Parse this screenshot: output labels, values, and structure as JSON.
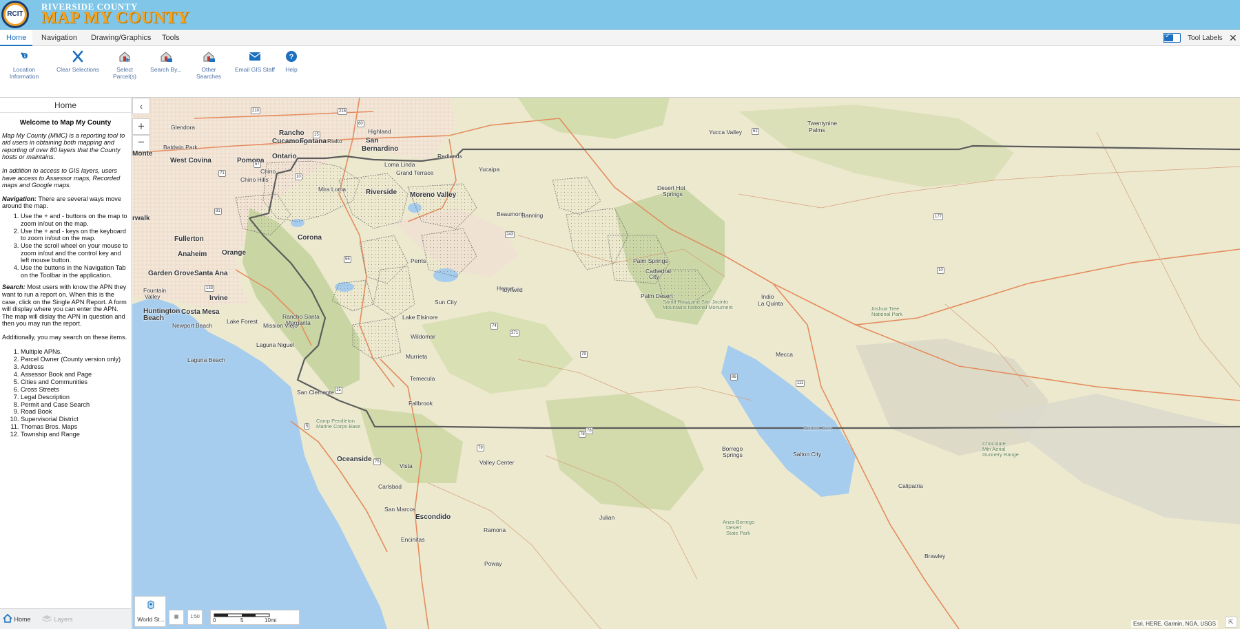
{
  "header": {
    "logo_text": "RCIT",
    "subtitle": "RIVERSIDE COUNTY",
    "title": "MAP MY COUNTY"
  },
  "menu": {
    "tabs": [
      {
        "label": "Home",
        "active": true
      },
      {
        "label": "Navigation"
      },
      {
        "label": "Drawing/Graphics"
      },
      {
        "label": "Tools"
      }
    ],
    "tool_labels": "Tool Labels",
    "tool_labels_checked": true,
    "close": "✕"
  },
  "ribbon": {
    "buttons": [
      {
        "label_line1": "Location",
        "label_line2": "Information",
        "icon": "location-info-icon"
      },
      {
        "label_line1": "Clear Selections",
        "icon": "clear-x-icon"
      },
      {
        "label_line1": "Select Parcel(s)",
        "icon": "select-parcel-icon"
      },
      {
        "label_line1": "Search By...",
        "icon": "search-by-icon"
      },
      {
        "label_line1": "Other Searches",
        "icon": "other-searches-icon"
      },
      {
        "label_line1": "Email GIS Staff",
        "icon": "email-icon"
      },
      {
        "label_line1": "Help",
        "icon": "help-icon"
      }
    ]
  },
  "panel": {
    "title": "Home",
    "welcome": "Welcome to Map My County",
    "intro": "Map My County (MMC) is a reporting tool to aid users in obtaining both mapping and reporting of over 80 layers that the County hosts or maintains.",
    "access": "In addition to access to GIS layers, users have access to Assessor maps, Recorded maps and Google maps.",
    "nav_label": "Navigation:",
    "nav_text": " There are several ways move around the map.",
    "nav_items": [
      "Use the + and - buttons on the map to zoom in/out on the map.",
      "Use the + and - keys on the keyboard to zoom in/out on the map.",
      "Use the scroll wheel on your mouse to zoom in/out and the control key and left mouse button.",
      "Use the buttons in the Navigation Tab on the Toolbar in the application."
    ],
    "search_label": "Search:",
    "search_text": " Most users with know the APN they want to run a report on. When this is the case, click on the Single APN Report. A form will display where you can enter the APN. The map will dislay the APN in question and then you may run the report.",
    "additional": "Additionally, you may search on these items.",
    "search_items": [
      "Multiple APNs.",
      "Parcel Owner (County version only)",
      "Address",
      "Assessor Book and Page",
      "Cities and Communities",
      "Cross Streets",
      "Legal Description",
      "Permit and Case Search",
      "Road Book",
      "Supervisorial District",
      "Thomas Bros. Maps",
      "Township and Range"
    ],
    "footer": {
      "home": "Home",
      "layers": "Layers"
    }
  },
  "map": {
    "collapse": "‹",
    "zoom_in": "+",
    "zoom_out": "−",
    "basemap_label": "World St...",
    "scale": {
      "t0": "0",
      "t1": "5",
      "t2": "10mi"
    },
    "attribution": "Esri, HERE, Garmin, NGA, USGS",
    "mini1": "▦",
    "mini2": "1:50",
    "corner": "⇱",
    "places": [
      {
        "t": "Glendora",
        "cls": ""
      },
      {
        "t": "Rancho",
        "cls": "big"
      },
      {
        "t": "Cucamonga",
        "cls": "big"
      },
      {
        "t": "Fontana",
        "cls": "big"
      },
      {
        "t": "Rialto",
        "cls": ""
      },
      {
        "t": "Highland",
        "cls": ""
      },
      {
        "t": "San",
        "cls": "big"
      },
      {
        "t": "Bernardino",
        "cls": "big"
      },
      {
        "t": "Baldwin Park",
        "cls": ""
      },
      {
        "t": "Monte",
        "cls": "big"
      },
      {
        "t": "West Covina",
        "cls": "big"
      },
      {
        "t": "Pomona",
        "cls": "big"
      },
      {
        "t": "Ontario",
        "cls": "big"
      },
      {
        "t": "Redlands",
        "cls": ""
      },
      {
        "t": "Loma Linda",
        "cls": ""
      },
      {
        "t": "Grand Terrace",
        "cls": ""
      },
      {
        "t": "Yucaipa",
        "cls": ""
      },
      {
        "t": "Chino",
        "cls": ""
      },
      {
        "t": "Chino Hills",
        "cls": ""
      },
      {
        "t": "Mira Loma",
        "cls": ""
      },
      {
        "t": "Riverside",
        "cls": "big"
      },
      {
        "t": "Moreno Valley",
        "cls": "big"
      },
      {
        "t": "Beaumont",
        "cls": ""
      },
      {
        "t": "Banning",
        "cls": ""
      },
      {
        "t": "Yucca Valley",
        "cls": ""
      },
      {
        "t": "Twentynine",
        "cls": ""
      },
      {
        "t": "Palms",
        "cls": ""
      },
      {
        "t": "Desert Hot",
        "cls": ""
      },
      {
        "t": "Springs",
        "cls": ""
      },
      {
        "t": "rwalk",
        "cls": "big"
      },
      {
        "t": "Fullerton",
        "cls": "big"
      },
      {
        "t": "Corona",
        "cls": "big"
      },
      {
        "t": "Anaheim",
        "cls": "big"
      },
      {
        "t": "Orange",
        "cls": "big"
      },
      {
        "t": "Garden Grove",
        "cls": "big"
      },
      {
        "t": "Santa Ana",
        "cls": "big"
      },
      {
        "t": "Fountain",
        "cls": ""
      },
      {
        "t": "Valley",
        "cls": ""
      },
      {
        "t": "Irvine",
        "cls": "big"
      },
      {
        "t": "Huntington",
        "cls": "big"
      },
      {
        "t": "Beach",
        "cls": "big"
      },
      {
        "t": "Costa Mesa",
        "cls": "big"
      },
      {
        "t": "Newport Beach",
        "cls": ""
      },
      {
        "t": "Lake Forest",
        "cls": ""
      },
      {
        "t": "Rancho Santa",
        "cls": ""
      },
      {
        "t": "Margarita",
        "cls": ""
      },
      {
        "t": "Mission Viejo",
        "cls": ""
      },
      {
        "t": "Laguna Niguel",
        "cls": ""
      },
      {
        "t": "Laguna Beach",
        "cls": ""
      },
      {
        "t": "Perris",
        "cls": ""
      },
      {
        "t": "Hemet",
        "cls": ""
      },
      {
        "t": "Sun City",
        "cls": ""
      },
      {
        "t": "Lake Elsinore",
        "cls": ""
      },
      {
        "t": "Wildomar",
        "cls": ""
      },
      {
        "t": "Murrieta",
        "cls": ""
      },
      {
        "t": "Temecula",
        "cls": ""
      },
      {
        "t": "Idyllwild",
        "cls": ""
      },
      {
        "t": "Palm Springs",
        "cls": ""
      },
      {
        "t": "Cathedral",
        "cls": ""
      },
      {
        "t": "City",
        "cls": ""
      },
      {
        "t": "Palm Desert",
        "cls": ""
      },
      {
        "t": "Indio",
        "cls": ""
      },
      {
        "t": "La Quinta",
        "cls": ""
      },
      {
        "t": "Mecca",
        "cls": ""
      },
      {
        "t": "Joshua Tree",
        "cls": "park"
      },
      {
        "t": "National Park",
        "cls": "park"
      },
      {
        "t": "Santa Rosa and San Jacinto",
        "cls": "park"
      },
      {
        "t": "Mountains National Monument",
        "cls": "park"
      },
      {
        "t": "San Clemente",
        "cls": ""
      },
      {
        "t": "Fallbrook",
        "cls": ""
      },
      {
        "t": "Camp Pendleton",
        "cls": "park"
      },
      {
        "t": "Marine Corps Base",
        "cls": "park"
      },
      {
        "t": "Oceanside",
        "cls": "big"
      },
      {
        "t": "Vista",
        "cls": ""
      },
      {
        "t": "Carlsbad",
        "cls": ""
      },
      {
        "t": "San Marcos",
        "cls": ""
      },
      {
        "t": "Escondido",
        "cls": "big"
      },
      {
        "t": "Valley Center",
        "cls": ""
      },
      {
        "t": "Encinitas",
        "cls": ""
      },
      {
        "t": "Ramona",
        "cls": ""
      },
      {
        "t": "Poway",
        "cls": ""
      },
      {
        "t": "Julian",
        "cls": ""
      },
      {
        "t": "Borrego",
        "cls": ""
      },
      {
        "t": "Springs",
        "cls": ""
      },
      {
        "t": "Anza-Borrego",
        "cls": "park"
      },
      {
        "t": "Desert",
        "cls": "park"
      },
      {
        "t": "State Park",
        "cls": "park"
      },
      {
        "t": "Salton City",
        "cls": ""
      },
      {
        "t": "Salton Sea",
        "cls": "water"
      },
      {
        "t": "Calipatria",
        "cls": ""
      },
      {
        "t": "Brawley",
        "cls": ""
      },
      {
        "t": "Chocolate",
        "cls": "park"
      },
      {
        "t": "Mtn Aerial",
        "cls": "park"
      },
      {
        "t": "Gunnery Range",
        "cls": "park"
      }
    ],
    "shields": [
      "210",
      "215",
      "15",
      "10",
      "60",
      "57",
      "71",
      "91",
      "55",
      "133",
      "74",
      "79",
      "243",
      "371",
      "62",
      "177",
      "10",
      "86",
      "111",
      "78",
      "5",
      "15",
      "76",
      "78",
      "79"
    ]
  },
  "colors": {
    "banner": "#7fc6e8",
    "title": "#f7a21b",
    "accent": "#1d6fbf",
    "water": "#a6cdee",
    "terrain": "#cdd9a4",
    "urban": "#f1e4d6",
    "boundary": "#5b5b5b"
  }
}
